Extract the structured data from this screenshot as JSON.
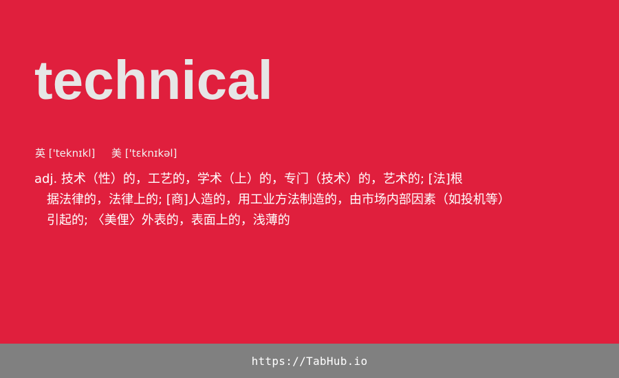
{
  "word": "technical",
  "phonetics": {
    "uk_label": "英",
    "uk_ipa": "['teknɪkl]",
    "us_label": "美",
    "us_ipa": "['tɛknɪkəl]"
  },
  "definition": {
    "lines": [
      "adj. 技术（性）的，工艺的，学术（上）的，专门（技术）的，艺术的; [法]根",
      "据法律的，法律上的; [商]人造的，用工业方法制造的，由市场内部因素（如投机等）",
      "引起的; 〈美俚〉外表的，表面上的，浅薄的"
    ]
  },
  "footer": {
    "url": "https://TabHub.io"
  },
  "colors": {
    "background": "#e01f3d",
    "word": "#e6e6e6",
    "footer_bg": "#808080"
  }
}
